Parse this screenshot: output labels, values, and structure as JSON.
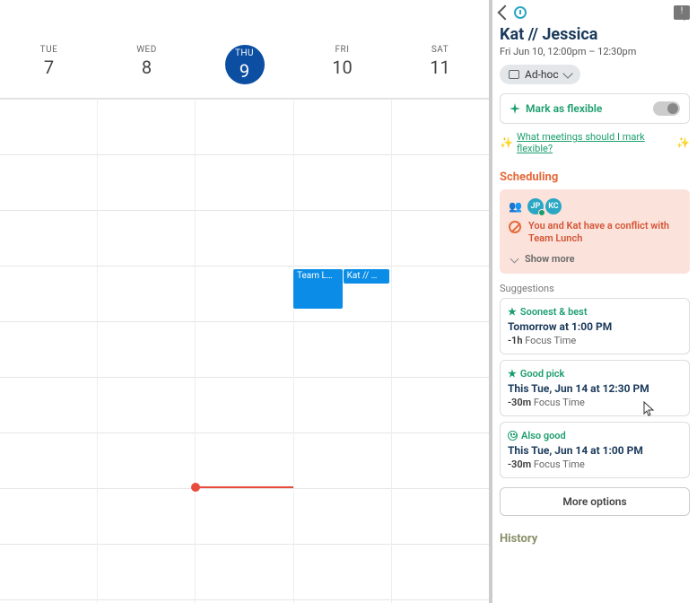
{
  "calendar": {
    "days": [
      {
        "dow": "TUE",
        "num": "7"
      },
      {
        "dow": "WED",
        "num": "8"
      },
      {
        "dow": "THU",
        "num": "9",
        "today": true
      },
      {
        "dow": "FRI",
        "num": "10"
      },
      {
        "dow": "SAT",
        "num": "11"
      }
    ],
    "events": {
      "team_lunch": "Team L…",
      "kat_jess": "Kat // …"
    }
  },
  "panel": {
    "feedback_glyph": "!",
    "title": "Kat // Jessica",
    "subtitle": "Fri Jun 10, 12:00pm – 12:30pm",
    "chip_label": "Ad-hoc",
    "flexible_label": "Mark as flexible",
    "flex_link": "What meetings should I mark flexible?",
    "sparkle_glyph": "✨",
    "scheduling_header": "Scheduling",
    "attendees": {
      "jp": "JP",
      "kc": "KC"
    },
    "conflict_text": "You and Kat have a conflict with Team Lunch",
    "show_more": "Show more",
    "suggestions_label": "Suggestions",
    "suggestions": [
      {
        "tag": "Soonest & best",
        "when": "Tomorrow at 1:00 PM",
        "delta": "-1h",
        "impact": "Focus Time"
      },
      {
        "tag": "Good pick",
        "when": "This Tue, Jun 14 at 12:30 PM",
        "delta": "-30m",
        "impact": "Focus Time"
      },
      {
        "tag": "Also good",
        "when": "This Tue, Jun 14 at 1:00 PM",
        "delta": "-30m",
        "impact": "Focus Time"
      }
    ],
    "more_options": "More options",
    "history_header": "History"
  }
}
